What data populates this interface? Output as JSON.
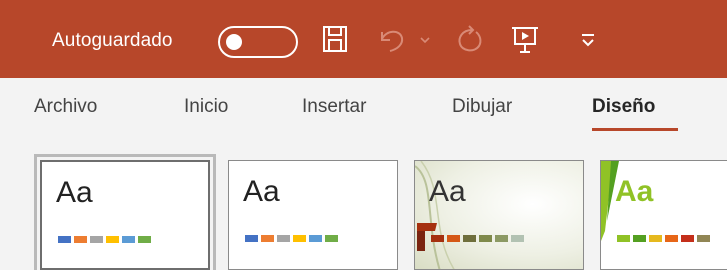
{
  "quick_access": {
    "autosave_label": "Autoguardado",
    "autosave_state": "off",
    "icons": [
      "save-icon",
      "undo-icon",
      "undo-dropdown-icon",
      "redo-icon",
      "present-from-beginning-icon",
      "customize-toolbar-icon"
    ]
  },
  "tabs": [
    {
      "label": "Archivo",
      "active": false
    },
    {
      "label": "Inicio",
      "active": false
    },
    {
      "label": "Insertar",
      "active": false
    },
    {
      "label": "Dibujar",
      "active": false
    },
    {
      "label": "Diseño",
      "active": true
    }
  ],
  "themes": [
    {
      "sample": "Aa",
      "selected": true,
      "swatches": [
        "#4472c4",
        "#ed7d31",
        "#a5a5a5",
        "#ffc000",
        "#5b9bd5",
        "#70ad47"
      ]
    },
    {
      "sample": "Aa",
      "selected": false,
      "swatches": [
        "#4472c4",
        "#ed7d31",
        "#a5a5a5",
        "#ffc000",
        "#5b9bd5",
        "#70ad47"
      ]
    },
    {
      "sample": "Aa",
      "selected": false,
      "swatches": [
        "#a5300f",
        "#d55816",
        "#6f6f3c",
        "#7f8a4b",
        "#8c9a64",
        "#b2c2b2"
      ]
    },
    {
      "sample": "Aa",
      "selected": false,
      "swatches": [
        "#90c226",
        "#54a021",
        "#e6b91e",
        "#e76618",
        "#c42f1a",
        "#918655"
      ]
    }
  ],
  "colors": {
    "title_bar": "#b7472a",
    "accent_underline": "#b7472a",
    "ribbon_bg": "#f3f3f3"
  }
}
